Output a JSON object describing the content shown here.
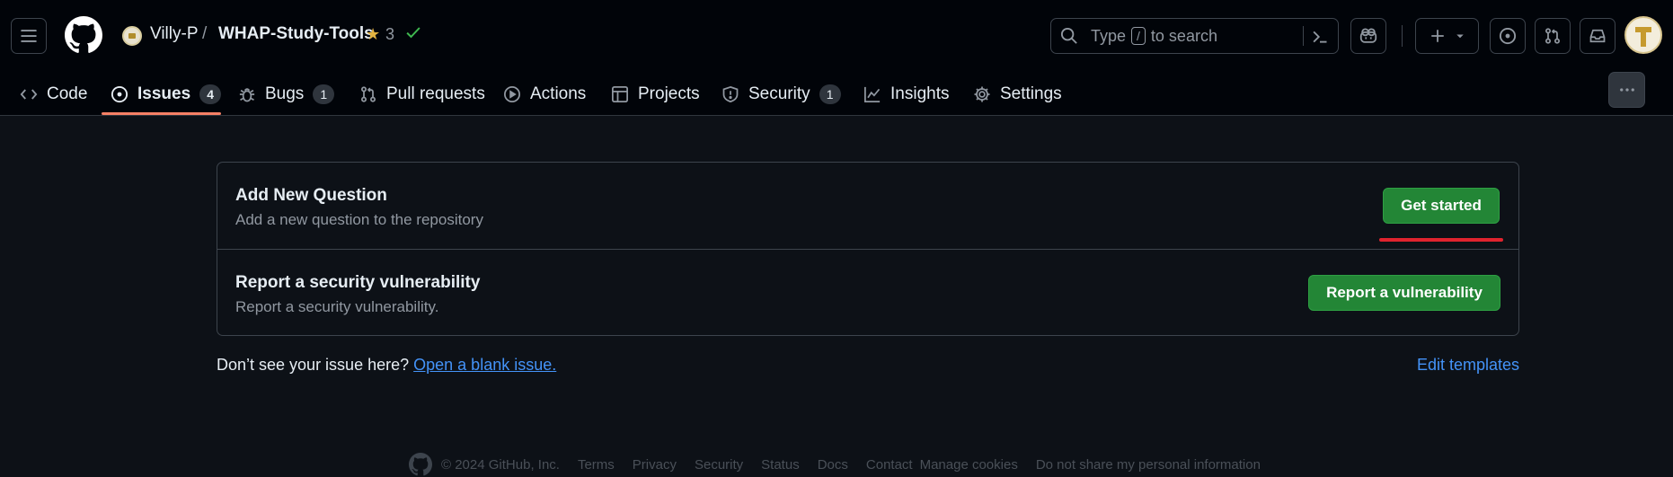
{
  "header": {
    "owner": "Villy-P",
    "separator": "/",
    "repo": "WHAP-Study-Tools",
    "stars": "3",
    "search": {
      "type_label": "Type",
      "key": "/",
      "rest": "to search"
    }
  },
  "tabs": [
    {
      "label": "Code",
      "icon": "code-icon"
    },
    {
      "label": "Issues",
      "counter": "4",
      "icon": "issue-opened-icon",
      "selected": true
    },
    {
      "label": "Bugs",
      "counter": "1",
      "icon": "bug-icon"
    },
    {
      "label": "Pull requests",
      "icon": "git-pull-request-icon"
    },
    {
      "label": "Actions",
      "icon": "play-icon"
    },
    {
      "label": "Projects",
      "icon": "table-icon"
    },
    {
      "label": "Security",
      "counter": "1",
      "icon": "shield-icon"
    },
    {
      "label": "Insights",
      "icon": "graph-icon"
    },
    {
      "label": "Settings",
      "icon": "gear-icon"
    }
  ],
  "templates": [
    {
      "title": "Add New Question",
      "description": "Add a new question to the repository",
      "button": "Get started"
    },
    {
      "title": "Report a security vulnerability",
      "description": "Report a security vulnerability.",
      "button": "Report a vulnerability"
    }
  ],
  "blank": {
    "prompt": "Don’t see your issue here?",
    "link": "Open a blank issue."
  },
  "edit_templates": "Edit templates",
  "footer": {
    "copyright": "© 2024 GitHub, Inc.",
    "links": [
      "Terms",
      "Privacy",
      "Security",
      "Status",
      "Docs",
      "Contact",
      "Manage cookies",
      "Do not share my personal information"
    ]
  },
  "colors": {
    "accent_underline": "#f78166",
    "primary_button": "#238636",
    "link": "#4493f8",
    "annotation": "#e0232e"
  }
}
